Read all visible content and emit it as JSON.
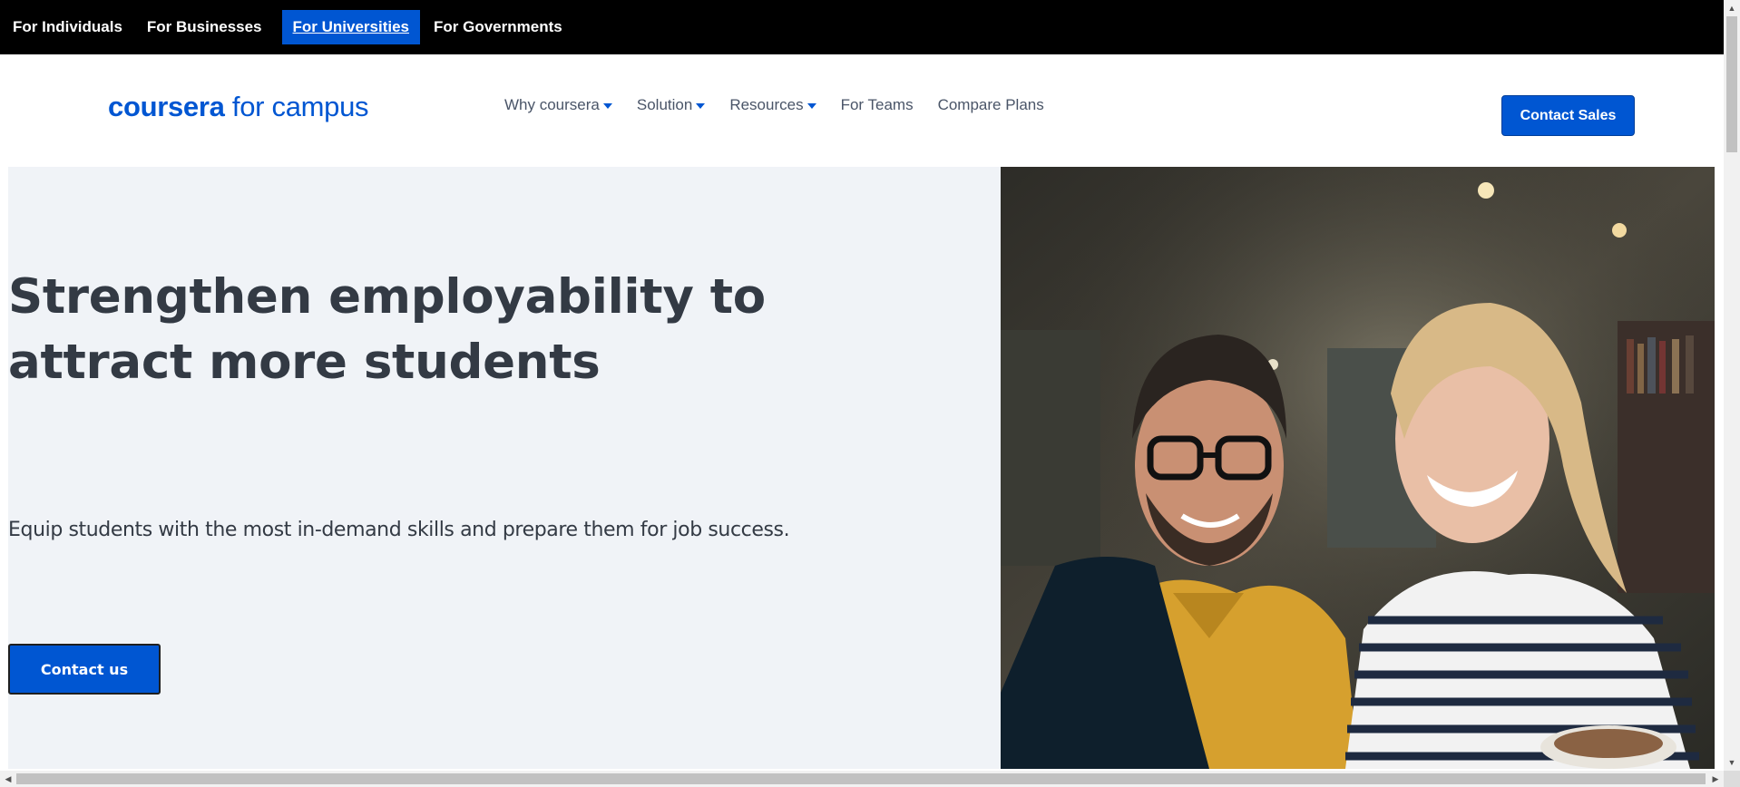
{
  "topbar": {
    "items": [
      "For Individuals",
      "For Businesses",
      "For Universities",
      "For Governments"
    ],
    "active_index": 2
  },
  "header": {
    "logo_brand": "coursera",
    "logo_product": "for campus",
    "nav": [
      {
        "label": "Why coursera",
        "dropdown": true
      },
      {
        "label": "Solution",
        "dropdown": true
      },
      {
        "label": "Resources",
        "dropdown": true
      },
      {
        "label": "For Teams",
        "dropdown": false
      },
      {
        "label": "Compare Plans",
        "dropdown": false
      }
    ],
    "cta_label": "Contact Sales"
  },
  "hero": {
    "title": "Strengthen employability to attract more students",
    "subtitle": "Equip students with the most in-demand skills and prepare them for job success.",
    "cta_label": "Contact us",
    "image_alt": "Two smiling students working together on a laptop in a library"
  },
  "colors": {
    "brand": "#0056d2",
    "topbar_bg": "#000000",
    "hero_bg": "#f0f3f7",
    "heading": "#333a44"
  }
}
